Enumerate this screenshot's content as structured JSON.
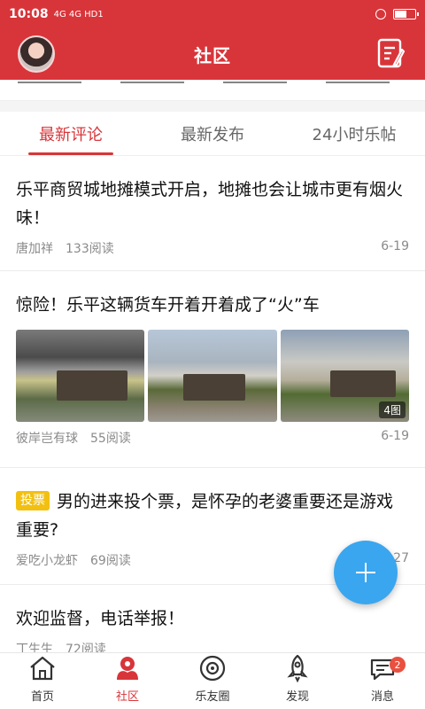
{
  "status_bar": {
    "time": "10:08",
    "signal_text": "4G 4G HD1"
  },
  "header": {
    "title": "社区"
  },
  "tabs": [
    {
      "label": "最新评论",
      "active": true
    },
    {
      "label": "最新发布",
      "active": false
    },
    {
      "label": "24小时乐帖",
      "active": false
    }
  ],
  "posts": [
    {
      "title": "乐平商贸城地摊模式开启，地摊也会让城市更有烟火味！",
      "author": "唐加祥",
      "reads": "133阅读",
      "date": "6-19"
    },
    {
      "title": "惊险！乐平这辆货车开着开着成了“火”车",
      "author": "彼岸岂有球",
      "reads": "55阅读",
      "date": "6-19",
      "image_count": "4图"
    },
    {
      "tag": "投票",
      "title": "男的进来投个票，是怀孕的老婆重要还是游戏重要?",
      "author": "爱吃小龙虾",
      "reads": "69阅读",
      "date": "6-27"
    },
    {
      "title": "欢迎监督，电话举报！",
      "author": "丁生生",
      "reads": "72阅读",
      "date": ""
    }
  ],
  "bottom_nav": [
    {
      "label": "首页",
      "icon": "home-icon"
    },
    {
      "label": "社区",
      "icon": "community-icon",
      "active": true
    },
    {
      "label": "乐友圈",
      "icon": "friends-circle-icon"
    },
    {
      "label": "发现",
      "icon": "rocket-icon"
    },
    {
      "label": "消息",
      "icon": "message-icon",
      "badge": "2"
    }
  ],
  "colors": {
    "brand_red": "#d8353a",
    "fab_blue": "#3aa6ef",
    "vote_tag": "#f2c011"
  }
}
